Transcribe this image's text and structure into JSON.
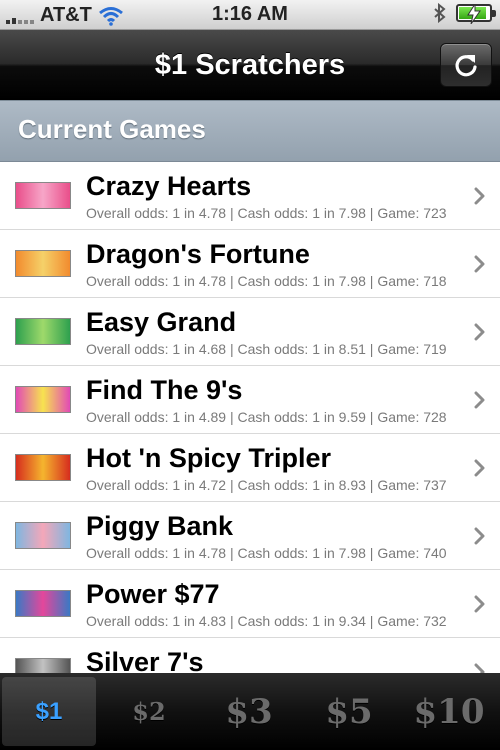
{
  "status_bar": {
    "carrier": "AT&T",
    "time": "1:16 AM"
  },
  "nav": {
    "title": "$1 Scratchers",
    "refresh_icon": "refresh-icon"
  },
  "section": {
    "title": "Current Games"
  },
  "games": [
    {
      "name": "Crazy Hearts",
      "details": "Overall odds: 1 in 4.78 | Cash odds: 1 in 7.98 | Game: 723",
      "colors": [
        "#e94e8a",
        "#f7a6c8"
      ]
    },
    {
      "name": "Dragon's Fortune",
      "details": "Overall odds: 1 in 4.78 | Cash odds: 1 in 7.98 | Game: 718",
      "colors": [
        "#f28b2e",
        "#f5d169"
      ]
    },
    {
      "name": "Easy Grand",
      "details": "Overall odds: 1 in 4.68 | Cash odds: 1 in 8.51 | Game: 719",
      "colors": [
        "#2ea04e",
        "#9ed96b"
      ]
    },
    {
      "name": "Find The 9's",
      "details": "Overall odds: 1 in 4.89 | Cash odds: 1 in 9.59 | Game: 728",
      "colors": [
        "#e24ab5",
        "#f7e34f"
      ]
    },
    {
      "name": "Hot 'n Spicy Tripler",
      "details": "Overall odds: 1 in 4.72 | Cash odds: 1 in 8.93 | Game: 737",
      "colors": [
        "#d62d1e",
        "#f5b52e"
      ]
    },
    {
      "name": "Piggy Bank",
      "details": "Overall odds: 1 in 4.78 | Cash odds: 1 in 7.98 | Game: 740",
      "colors": [
        "#7fb6e0",
        "#f4a7b9"
      ]
    },
    {
      "name": "Power $77",
      "details": "Overall odds: 1 in 4.83 | Cash odds: 1 in 9.34 | Game: 732",
      "colors": [
        "#3a79c4",
        "#e4479b"
      ]
    },
    {
      "name": "Silver 7's",
      "details": "",
      "colors": [
        "#555555",
        "#c2c2c2"
      ]
    }
  ],
  "tabs": [
    {
      "label": "$1",
      "active": true
    },
    {
      "label": "$2",
      "active": false
    },
    {
      "label": "$3",
      "active": false
    },
    {
      "label": "$5",
      "active": false
    },
    {
      "label": "$10",
      "active": false
    }
  ]
}
